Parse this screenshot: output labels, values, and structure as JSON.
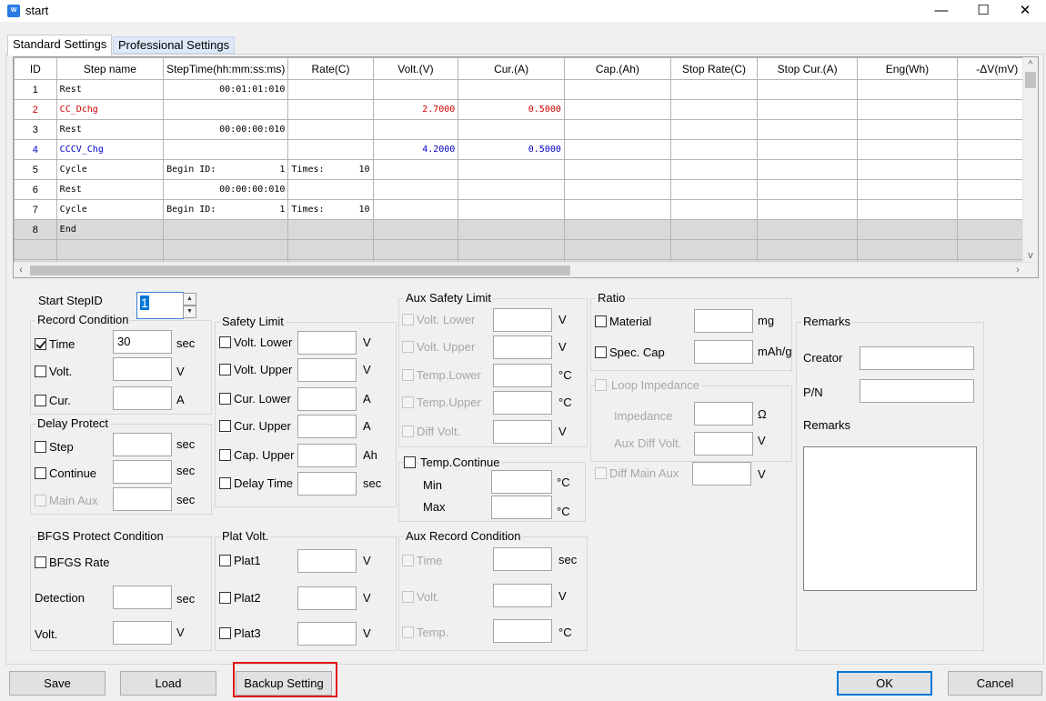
{
  "window": {
    "title": "start",
    "icon_text": "W",
    "minimize": "—",
    "maximize": "☐",
    "close": "✕"
  },
  "tabs": [
    {
      "label": "Standard Settings"
    },
    {
      "label": "Professional Settings"
    }
  ],
  "grid": {
    "columns": [
      "ID",
      "Step name",
      "StepTime(hh:mm:ss:ms)",
      "Rate(C)",
      "Volt.(V)",
      "Cur.(A)",
      "Cap.(Ah)",
      "Stop Rate(C)",
      "Stop Cur.(A)",
      "Eng(Wh)",
      "-ΔV(mV)"
    ],
    "rows": [
      {
        "id": "1",
        "name": "Rest",
        "time": "00:01:01:010",
        "rate": "",
        "rate_val": "",
        "time_val": "",
        "volt": "",
        "cur": ""
      },
      {
        "id": "2",
        "name": "CC_Dchg",
        "time": "",
        "rate": "",
        "rate_val": "",
        "time_val": "",
        "volt": "2.7000",
        "cur": "0.5000"
      },
      {
        "id": "3",
        "name": "Rest",
        "time": "00:00:00:010",
        "rate": "",
        "rate_val": "",
        "time_val": "",
        "volt": "",
        "cur": ""
      },
      {
        "id": "4",
        "name": "CCCV_Chg",
        "time": "",
        "rate": "",
        "rate_val": "",
        "time_val": "",
        "volt": "4.2000",
        "cur": "0.5000"
      },
      {
        "id": "5",
        "name": "Cycle",
        "time": "Begin ID:",
        "time_val": "1",
        "rate": "Times:",
        "rate_val": "10",
        "volt": "",
        "cur": ""
      },
      {
        "id": "6",
        "name": "Rest",
        "time": "00:00:00:010",
        "rate": "",
        "rate_val": "",
        "time_val": "",
        "volt": "",
        "cur": ""
      },
      {
        "id": "7",
        "name": "Cycle",
        "time": "Begin ID:",
        "time_val": "1",
        "rate": "Times:",
        "rate_val": "10",
        "volt": "",
        "cur": ""
      },
      {
        "id": "8",
        "name": "End",
        "time": "",
        "rate": "",
        "rate_val": "",
        "time_val": "",
        "volt": "",
        "cur": ""
      }
    ]
  },
  "start_step": {
    "label": "Start StepID",
    "value": "1"
  },
  "record_condition": {
    "title": "Record Condition",
    "time": {
      "label": "Time",
      "value": "30",
      "unit": "sec"
    },
    "volt": {
      "label": "Volt.",
      "unit": "V"
    },
    "cur": {
      "label": "Cur.",
      "unit": "A"
    }
  },
  "delay_protect": {
    "title": "Delay Protect",
    "step": {
      "label": "Step",
      "unit": "sec"
    },
    "continue": {
      "label": "Continue",
      "unit": "sec"
    },
    "main_aux": {
      "label": "Main Aux",
      "unit": "sec"
    }
  },
  "bfgs": {
    "title": "BFGS Protect Condition",
    "rate": "BFGS Rate",
    "detection": {
      "label": "Detection",
      "unit": "sec"
    },
    "volt": {
      "label": "Volt.",
      "unit": "V"
    }
  },
  "safety_limit": {
    "title": "Safety Limit",
    "items": [
      {
        "label": "Volt. Lower",
        "unit": "V"
      },
      {
        "label": "Volt. Upper",
        "unit": "V"
      },
      {
        "label": "Cur. Lower",
        "unit": "A"
      },
      {
        "label": "Cur. Upper",
        "unit": "A"
      },
      {
        "label": "Cap. Upper",
        "unit": "Ah"
      },
      {
        "label": "Delay Time",
        "unit": "sec"
      }
    ]
  },
  "plat_volt": {
    "title": "Plat Volt.",
    "items": [
      {
        "label": "Plat1",
        "unit": "V"
      },
      {
        "label": "Plat2",
        "unit": "V"
      },
      {
        "label": "Plat3",
        "unit": "V"
      }
    ]
  },
  "aux_safety": {
    "title": "Aux Safety Limit",
    "items": [
      {
        "label": "Volt. Lower",
        "unit": "V"
      },
      {
        "label": "Volt. Upper",
        "unit": "V"
      },
      {
        "label": "Temp.Lower",
        "unit": "°C"
      },
      {
        "label": "Temp.Upper",
        "unit": "°C"
      },
      {
        "label": "Diff Volt.",
        "unit": "V"
      }
    ]
  },
  "temp_continue": {
    "title": "Temp.Continue",
    "min": {
      "label": "Min",
      "unit": "°C"
    },
    "max": {
      "label": "Max",
      "unit": "°C"
    }
  },
  "aux_record": {
    "title": "Aux Record Condition",
    "time": {
      "label": "Time",
      "unit": "sec"
    },
    "volt": {
      "label": "Volt.",
      "unit": "V"
    },
    "temp": {
      "label": "Temp.",
      "unit": "°C"
    }
  },
  "ratio": {
    "title": "Ratio",
    "material": {
      "label": "Material",
      "unit": "mg"
    },
    "spec_cap": {
      "label": "Spec. Cap",
      "unit": "mAh/g"
    }
  },
  "loop_impedance": {
    "title": "Loop Impedance",
    "impedance": {
      "label": "Impedance",
      "unit": "Ω"
    },
    "aux_diff": {
      "label": "Aux Diff Volt.",
      "unit": "V"
    }
  },
  "diff_main_aux": {
    "label": "Diff Main Aux",
    "unit": "V"
  },
  "remarks": {
    "title": "Remarks",
    "creator": "Creator",
    "pn": "P/N",
    "remarks_label": "Remarks"
  },
  "buttons": {
    "save": "Save",
    "load": "Load",
    "backup": "Backup Setting",
    "ok": "OK",
    "cancel": "Cancel"
  },
  "colors": {
    "highlight": "#e0151b",
    "red_row": "#d00000",
    "blue_row": "#0000c8",
    "focus": "#0078d7"
  }
}
